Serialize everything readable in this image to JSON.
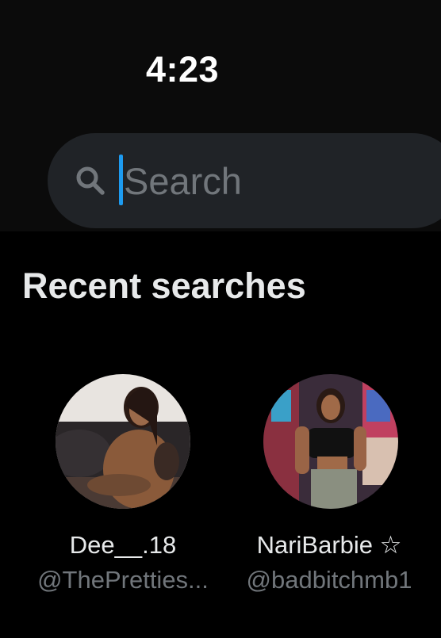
{
  "status_bar": {
    "time": "4:23"
  },
  "search": {
    "placeholder": "Search",
    "value": ""
  },
  "recent": {
    "title": "Recent searches",
    "items": [
      {
        "name": "Dee__.18",
        "handle": "@ThePretties..."
      },
      {
        "name": "NariBarbie ☆",
        "handle": "@badbitchmb1"
      }
    ]
  },
  "colors": {
    "background": "#000000",
    "search_field": "#202327",
    "caret_accent": "#1d9bf0",
    "secondary_text": "#71767b"
  },
  "icons": {
    "search": "search-icon"
  }
}
